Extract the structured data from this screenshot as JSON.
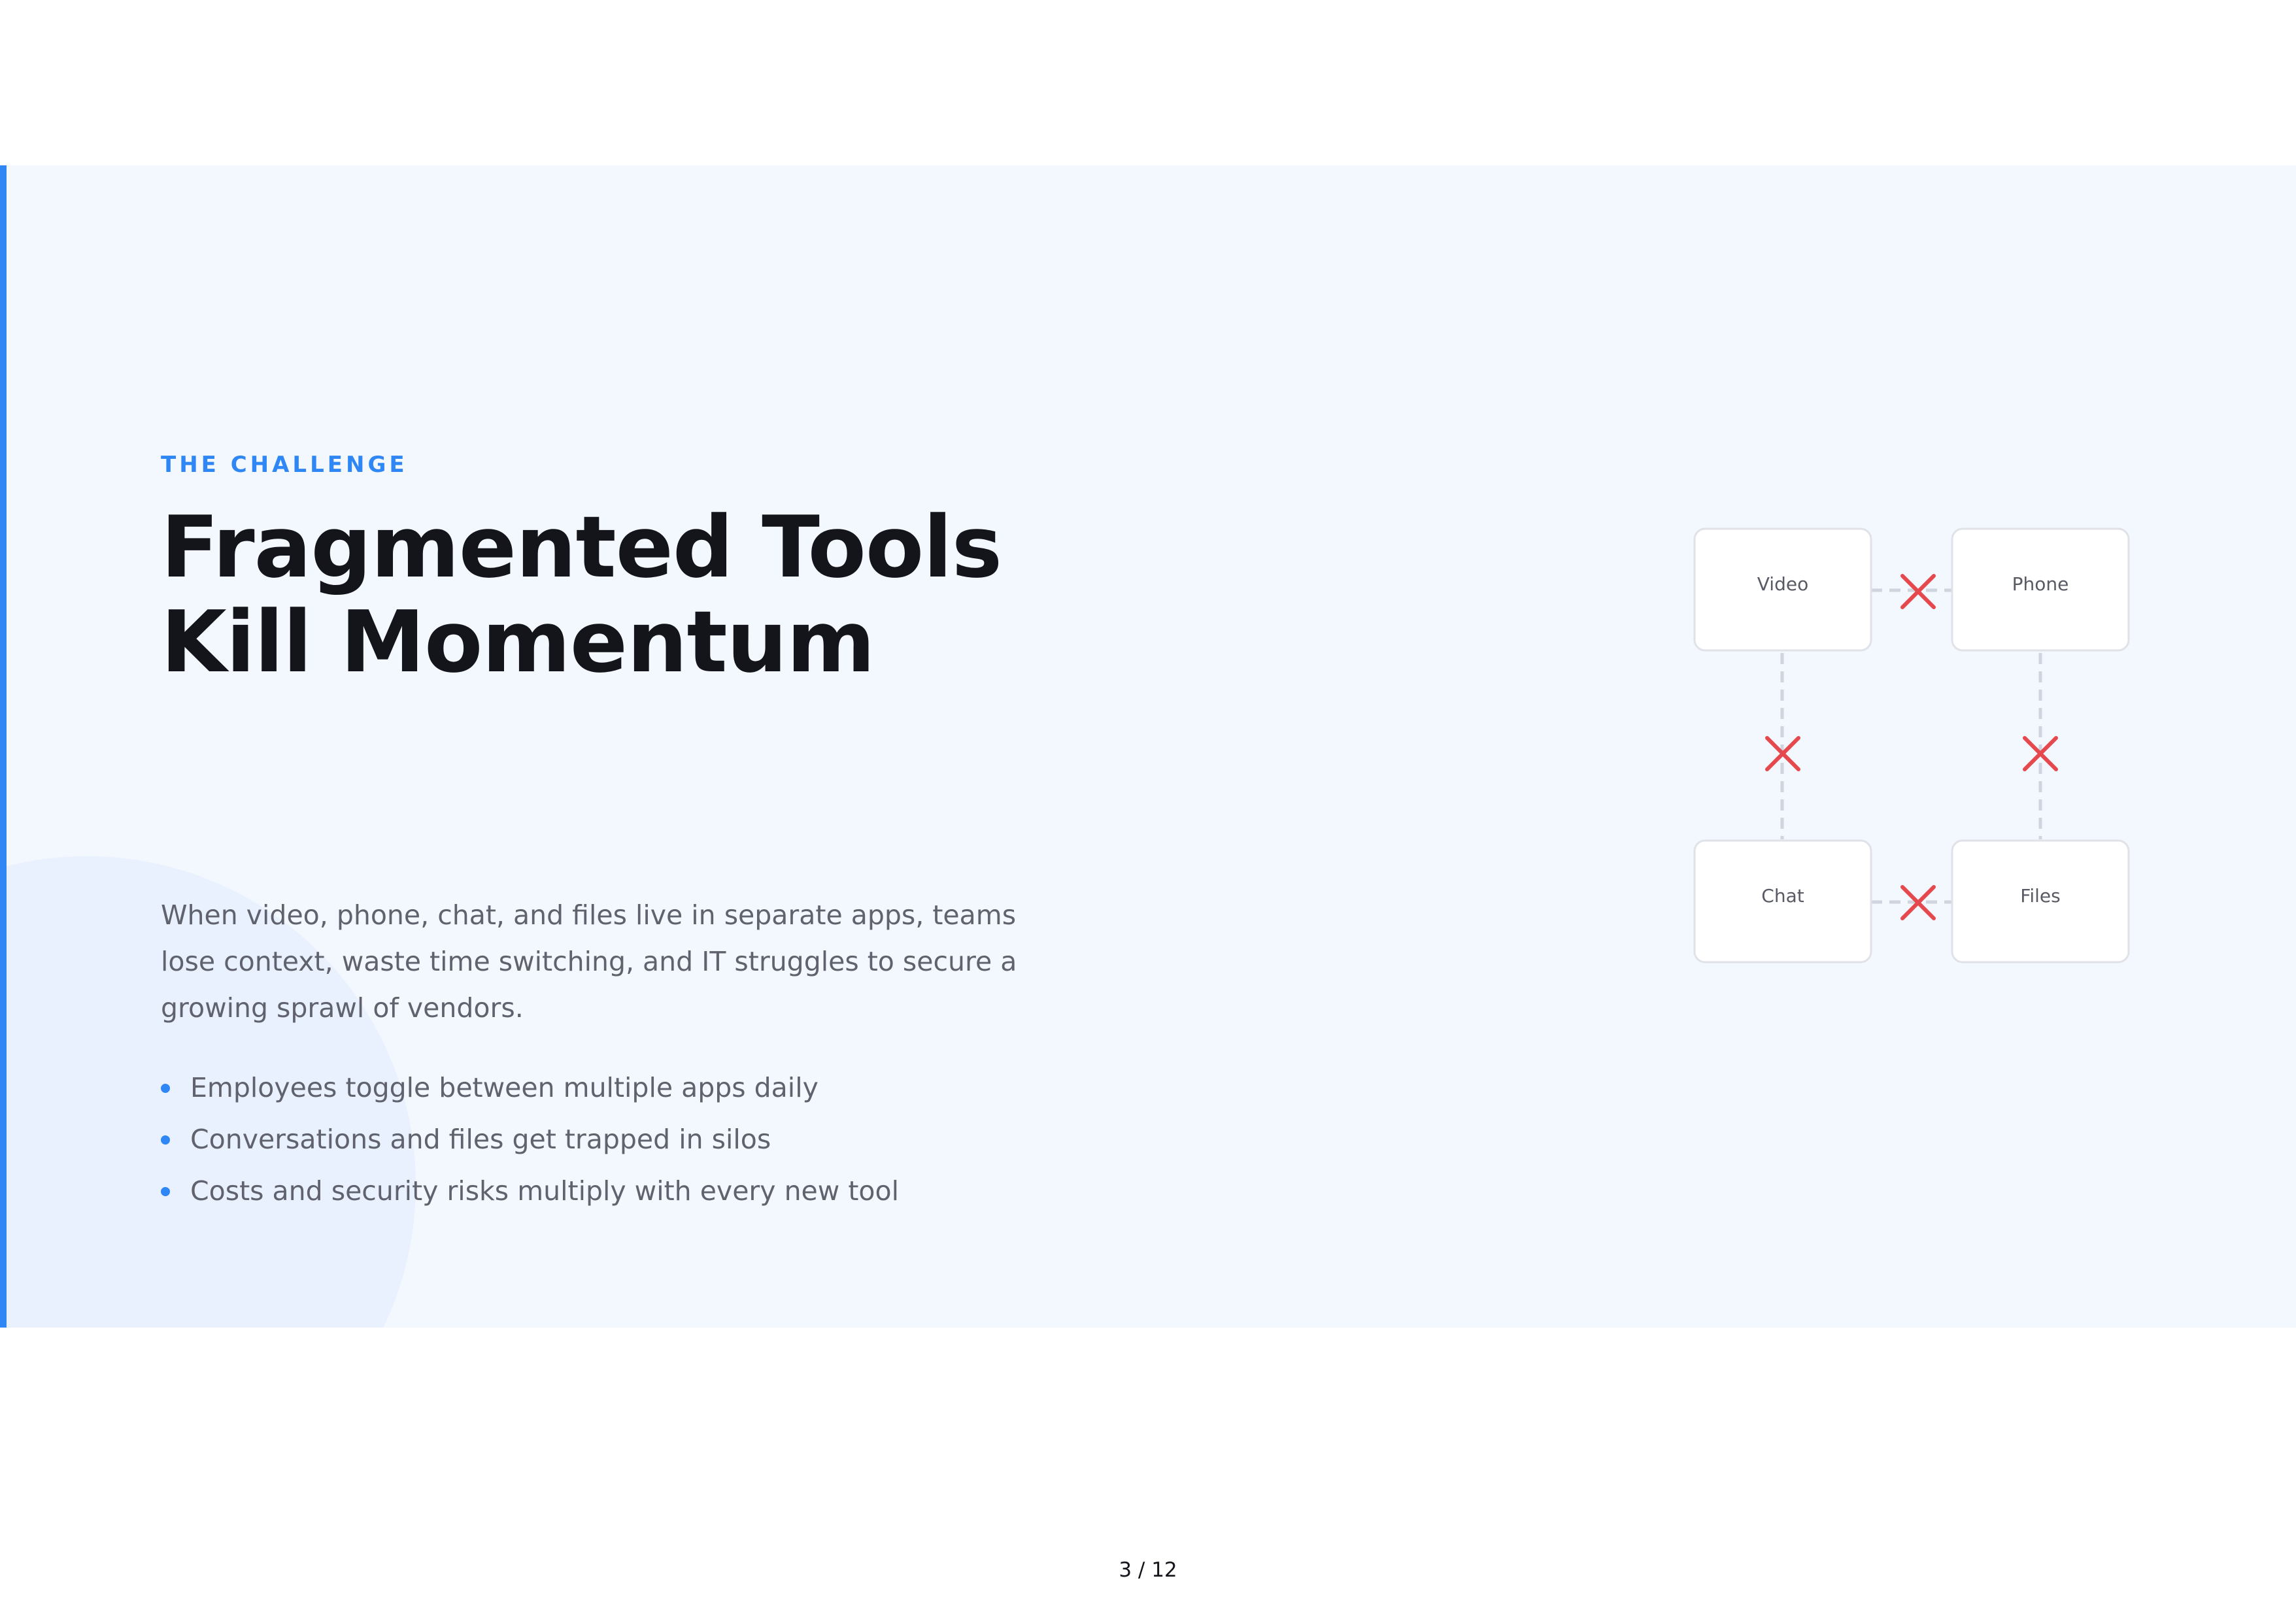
{
  "slide": {
    "eyebrow": "THE CHALLENGE",
    "title": "Fragmented Tools Kill Momentum",
    "body": "When video, phone, chat, and files live in separate apps, teams lose context, waste time switching, and IT struggles to secure a growing sprawl of vendors.",
    "bullets": [
      "Employees toggle between multiple apps daily",
      "Conversations and files get trapped in silos",
      "Costs and security risks multiply with every new tool"
    ]
  },
  "diagram": {
    "nodes": [
      "Video",
      "Phone",
      "Chat",
      "Files"
    ],
    "broken_links": [
      [
        "Video",
        "Phone"
      ],
      [
        "Video",
        "Chat"
      ],
      [
        "Phone",
        "Files"
      ],
      [
        "Chat",
        "Files"
      ]
    ],
    "link_icon": "x-mark-icon"
  },
  "footer": {
    "page_number": "3 / 12"
  },
  "colors": {
    "accent": "#2e87f4",
    "slide_background": "#f3f7fe",
    "title": "#14151a",
    "body": "#60626e",
    "x_mark": "#e5484d"
  }
}
